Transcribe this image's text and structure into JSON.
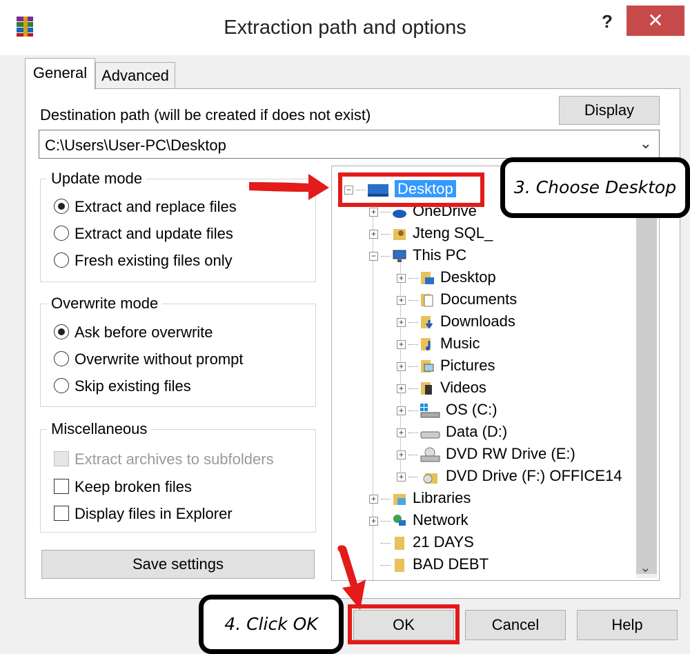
{
  "window": {
    "title": "Extraction path and options",
    "help_label": "?",
    "close_label": "✕"
  },
  "tabs": [
    {
      "label": "General",
      "active": true
    },
    {
      "label": "Advanced",
      "active": false
    }
  ],
  "destination": {
    "label": "Destination path (will be created if does not exist)",
    "value": "C:\\Users\\User-PC\\Desktop",
    "display_button": "Display"
  },
  "update_mode": {
    "title": "Update mode",
    "options": [
      {
        "label": "Extract and replace files",
        "selected": true
      },
      {
        "label": "Extract and update files",
        "selected": false
      },
      {
        "label": "Fresh existing files only",
        "selected": false
      }
    ]
  },
  "overwrite_mode": {
    "title": "Overwrite mode",
    "options": [
      {
        "label": "Ask before overwrite",
        "selected": true
      },
      {
        "label": "Overwrite without prompt",
        "selected": false
      },
      {
        "label": "Skip existing files",
        "selected": false
      }
    ]
  },
  "misc": {
    "title": "Miscellaneous",
    "options": [
      {
        "label": "Extract archives to subfolders",
        "checked": false,
        "disabled": true
      },
      {
        "label": "Keep broken files",
        "checked": false,
        "disabled": false
      },
      {
        "label": "Display files in Explorer",
        "checked": false,
        "disabled": false
      }
    ]
  },
  "save_settings": "Save settings",
  "tree": {
    "items": [
      {
        "label": "Desktop",
        "icon": "desktop-icon",
        "selected": true
      },
      {
        "label": "OneDrive",
        "icon": "onedrive-icon"
      },
      {
        "label": "Jteng SQL_",
        "icon": "user-folder-icon"
      },
      {
        "label": "This PC",
        "icon": "computer-icon"
      },
      {
        "label": "Desktop",
        "icon": "desktop-folder-icon"
      },
      {
        "label": "Documents",
        "icon": "documents-icon"
      },
      {
        "label": "Downloads",
        "icon": "downloads-icon"
      },
      {
        "label": "Music",
        "icon": "music-icon"
      },
      {
        "label": "Pictures",
        "icon": "pictures-icon"
      },
      {
        "label": "Videos",
        "icon": "videos-icon"
      },
      {
        "label": "OS (C:)",
        "icon": "os-drive-icon"
      },
      {
        "label": "Data (D:)",
        "icon": "drive-icon"
      },
      {
        "label": "DVD RW Drive (E:)",
        "icon": "dvd-rw-drive-icon"
      },
      {
        "label": "DVD Drive (F:) OFFICE14",
        "icon": "dvd-drive-icon"
      },
      {
        "label": "Libraries",
        "icon": "libraries-icon"
      },
      {
        "label": "Network",
        "icon": "network-icon"
      },
      {
        "label": "21 DAYS",
        "icon": "folder-icon"
      },
      {
        "label": "BAD DEBT",
        "icon": "folder-icon"
      }
    ]
  },
  "buttons": {
    "ok": "OK",
    "cancel": "Cancel",
    "help": "Help"
  },
  "annotations": {
    "step3": "3. Choose Desktop",
    "step4": "4. Click OK"
  },
  "colors": {
    "selection": "#3399ff",
    "annotation_red": "#e31b1b",
    "close_button": "#c74a4a"
  }
}
